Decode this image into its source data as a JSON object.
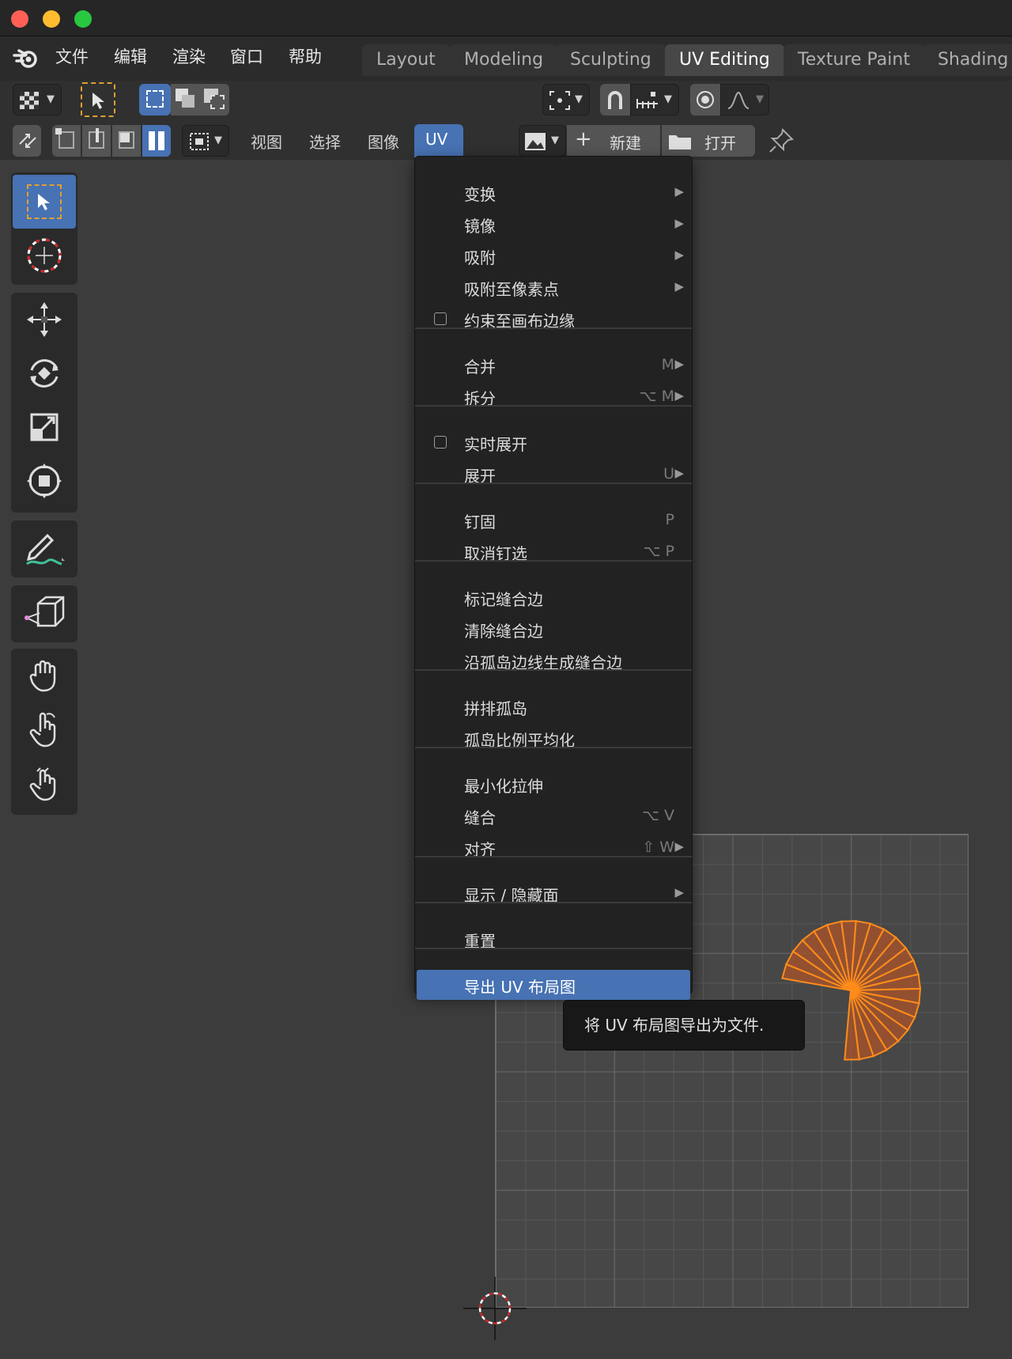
{
  "topmenu": {
    "items": [
      "文件",
      "编辑",
      "渲染",
      "窗口",
      "帮助"
    ]
  },
  "workspace_tabs": [
    {
      "label": "Layout",
      "active": false
    },
    {
      "label": "Modeling",
      "active": false
    },
    {
      "label": "Sculpting",
      "active": false
    },
    {
      "label": "UV Editing",
      "active": true
    },
    {
      "label": "Texture Paint",
      "active": false
    },
    {
      "label": "Shading",
      "active": false
    }
  ],
  "editor_header": {
    "menus": [
      "视图",
      "选择",
      "图像",
      "UV"
    ],
    "new_label": "新建",
    "open_label": "打开"
  },
  "uv_menu": {
    "items": [
      {
        "label": "变换",
        "shortcut": "",
        "submenu": true
      },
      {
        "label": "镜像",
        "shortcut": "",
        "submenu": true
      },
      {
        "label": "吸附",
        "shortcut": "",
        "submenu": true
      },
      {
        "label": "吸附至像素点",
        "shortcut": "",
        "submenu": true
      },
      {
        "label": "约束至画布边缘",
        "shortcut": "",
        "checkbox": true
      },
      {
        "label": "合并",
        "shortcut": "M",
        "submenu": true
      },
      {
        "label": "拆分",
        "shortcut": "⌥ M",
        "submenu": true
      },
      {
        "label": "实时展开",
        "shortcut": "",
        "checkbox": true
      },
      {
        "label": "展开",
        "shortcut": "U",
        "submenu": true
      },
      {
        "label": "钉固",
        "shortcut": "P"
      },
      {
        "label": "取消钉选",
        "shortcut": "⌥ P"
      },
      {
        "label": "标记缝合边",
        "shortcut": ""
      },
      {
        "label": "清除缝合边",
        "shortcut": ""
      },
      {
        "label": "沿孤岛边线生成缝合边",
        "shortcut": ""
      },
      {
        "label": "拼排孤岛",
        "shortcut": ""
      },
      {
        "label": "孤岛比例平均化",
        "shortcut": ""
      },
      {
        "label": "最小化拉伸",
        "shortcut": ""
      },
      {
        "label": "缝合",
        "shortcut": "⌥ V"
      },
      {
        "label": "对齐",
        "shortcut": "⇧ W",
        "submenu": true
      },
      {
        "label": "显示 / 隐藏面",
        "shortcut": "",
        "submenu": true
      },
      {
        "label": "重置",
        "shortcut": ""
      },
      {
        "label": "导出 UV 布局图",
        "shortcut": "",
        "highlighted": true
      }
    ]
  },
  "tooltip": {
    "text": "将 UV 布局图导出为文件."
  },
  "colors": {
    "accent": "#4772b3",
    "uv_mesh": "#ff8c1a",
    "uv_fill": "#a0522d"
  }
}
